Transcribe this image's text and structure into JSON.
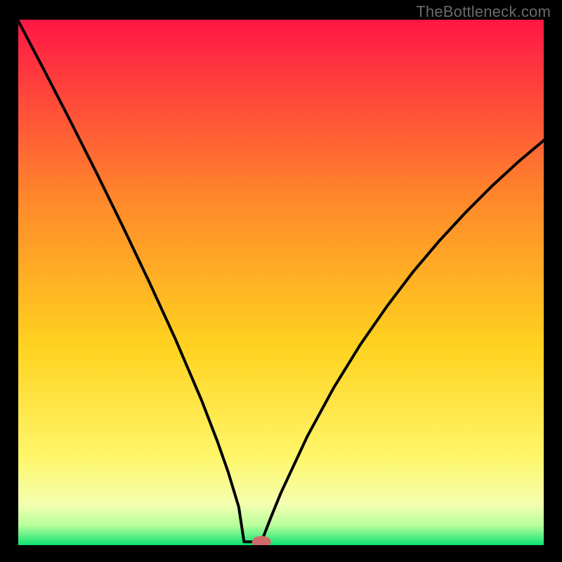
{
  "watermark": {
    "text": "TheBottleneck.com"
  },
  "colors": {
    "border": "#000000",
    "curve": "#000000",
    "gradient_top": "#ff1646",
    "gradient_mid1": "#ff8a2a",
    "gradient_mid2": "#ffd21f",
    "gradient_mid3": "#fff66a",
    "gradient_mid4": "#f4ffb0",
    "gradient_bottom_upper": "#b7ff9a",
    "gradient_bottom": "#00e171",
    "marker_fill": "#d06a6a",
    "marker_stroke": "#d06a6a"
  },
  "chart_data": {
    "type": "line",
    "title": "",
    "xlabel": "",
    "ylabel": "",
    "xlim": [
      0,
      100
    ],
    "ylim": [
      0,
      100
    ],
    "grid": false,
    "legend": false,
    "series": [
      {
        "name": "curve-left",
        "x": [
          0,
          5,
          10,
          15,
          20,
          25,
          30,
          35,
          38,
          40,
          42,
          43
        ],
        "y": [
          100,
          90.5,
          80.8,
          70.9,
          60.7,
          50.2,
          39.3,
          27.6,
          19.8,
          14.1,
          7.5,
          0.9
        ]
      },
      {
        "name": "minimum-flat",
        "x": [
          43,
          46.3
        ],
        "y": [
          0.9,
          0.9
        ]
      },
      {
        "name": "curve-right",
        "x": [
          46.3,
          48,
          50,
          55,
          60,
          65,
          70,
          75,
          80,
          85,
          90,
          95,
          100
        ],
        "y": [
          0.9,
          5.3,
          10.2,
          20.9,
          30.1,
          38.2,
          45.4,
          52.0,
          57.9,
          63.3,
          68.3,
          72.9,
          77.1
        ]
      }
    ],
    "marker": {
      "x": 46.3,
      "y": 0.9,
      "rx": 1.8,
      "ry": 1.1
    }
  }
}
